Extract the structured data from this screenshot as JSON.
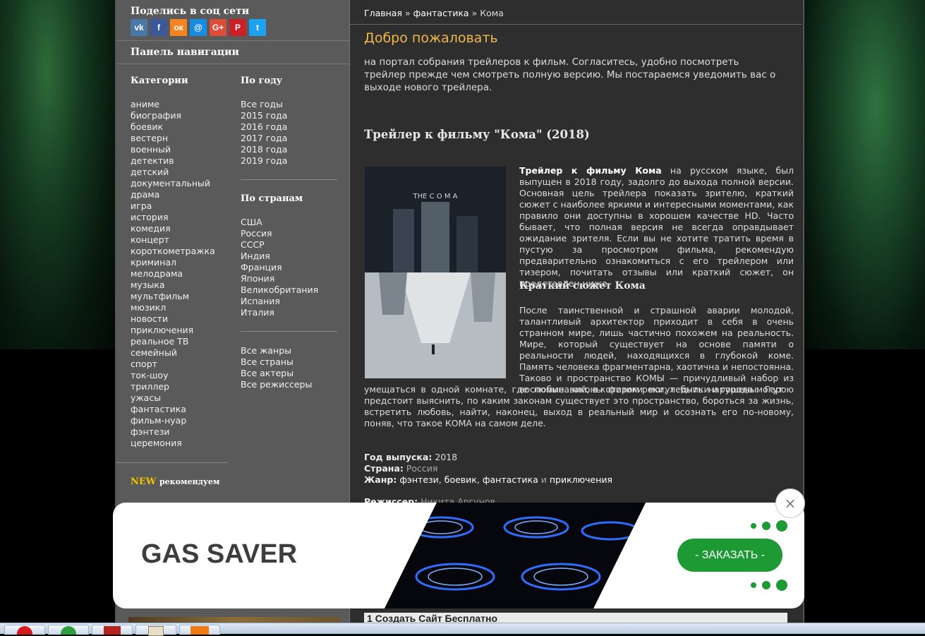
{
  "breadcrumb": {
    "home": "Главная",
    "sep1": "»",
    "category": "фантастика",
    "sep2": "»",
    "current": "Кома"
  },
  "sidebar": {
    "share_title": "Поделись в соц сети",
    "social_icons": [
      {
        "name": "vk-icon",
        "glyph": "vk",
        "color": "#4a76a8"
      },
      {
        "name": "facebook-icon",
        "glyph": "f",
        "color": "#3b5998"
      },
      {
        "name": "odnoklassniki-icon",
        "glyph": "ок",
        "color": "#f48420"
      },
      {
        "name": "moimir-icon",
        "glyph": "@",
        "color": "#168de2"
      },
      {
        "name": "googleplus-icon",
        "glyph": "G+",
        "color": "#dd4b39"
      },
      {
        "name": "pinterest-icon",
        "glyph": "P",
        "color": "#cb2027"
      },
      {
        "name": "twitter-icon",
        "glyph": "t",
        "color": "#1da1f2"
      }
    ],
    "nav_title": "Панель навигации",
    "categories_title": "Категории",
    "categories": [
      "аниме",
      "биография",
      "боевик",
      "вестерн",
      "военный",
      "детектив",
      "детский",
      "документальный",
      "драма",
      "игра",
      "история",
      "комедия",
      "концерт",
      "короткометражка",
      "криминал",
      "мелодрама",
      "музыка",
      "мультфильм",
      "мюзикл",
      "новости",
      "приключения",
      "реальное ТВ",
      "семейный",
      "спорт",
      "ток-шоу",
      "триллер",
      "ужасы",
      "фантастика",
      "фильм-нуар",
      "фэнтези",
      "церемония"
    ],
    "years_title": "По году",
    "years": [
      "Все годы",
      "2015 года",
      "2016 года",
      "2017 года",
      "2018 года",
      "2019 года"
    ],
    "countries_title": "По странам",
    "countries": [
      "США",
      "Россия",
      "СССР",
      "Индия",
      "Франция",
      "Япония",
      "Великобритания",
      "Испания",
      "Италия"
    ],
    "all_links": [
      "Все жанры",
      "Все страны",
      "Все актеры",
      "Все режиссеры"
    ],
    "new_label": "NEW",
    "new_sub": "рекомендуем"
  },
  "main": {
    "welcome": "Добро пожаловать",
    "intro": "на портал собрания трейлеров к фильм. Согласитесь, удобно посмотреть трейлер прежде чем смотреть полную версию. Мы постараемся уведомить вас о выходе нового трейлера.",
    "movie_title": "Трейлер к фильму \"Кома\" (2018)",
    "poster_text": "THE C O M A",
    "desc_bold": "Трейлер к фильму Кома",
    "desc_rest": " на русском языке, был выпущен в 2018 году, задолго до выхода полной версии. Основная цель трейлера показать зрителю, краткий сюжет с наиболее яркими и интересными моментами, как правило они доступны в хорошем качестве HD. Часто бывает, что полная версия не всегда оправдывает ожидание зрителя. Если вы не хотите тратить время в пустую за просмотром фильма, рекомендую предварительно ознакомиться с его трейлером или тизером, почитать отзывы или краткий сюжет, он представлен ниже.",
    "plot_title": "Краткий сюжет Кома",
    "plot_part1": "После таинственной и страшной аварии молодой, талантливый архитектор приходит в себя в очень странном мире, лишь частично похожем на реальность. Мире, который существует на основе памяти о реальности людей, находящихся в глубокой коме. Память человека фрагментарна, хаотична и непостоянна. Таково и пространство КОМЫ — причудливый набор из воспоминаний, в котором реки, ледники и города могут",
    "plot_part2": "умещаться в одной комнате, где любые законы физики могут быть нарушены. Герою предстоит выяснить, по каким законам существует это пространство, бороться за жизнь, встретить любовь, найти, наконец, выход в реальный мир и осознать его по-новому, поняв, что такое КОМА на самом деле.",
    "year_label": "Год выпуска:",
    "year_value": "2018",
    "country_label": "Страна:",
    "country_value": "Россия",
    "genre_label": "Жанр:",
    "genres": [
      "фэнтези",
      "боевик",
      "фантастика",
      "приключения"
    ],
    "genre_sep1": ",",
    "genre_sep2": ",",
    "genre_and": "и",
    "director_label": "Режиссер:",
    "director_value": "Никита Аргунов"
  },
  "ad": {
    "brand": "GAS SAVER",
    "button": "- ЗАКАЗАТЬ -",
    "close": "×",
    "accent": "#1e9a35"
  },
  "bottom_banner": {
    "text": "1  Создать Сайт Бесплатно"
  }
}
